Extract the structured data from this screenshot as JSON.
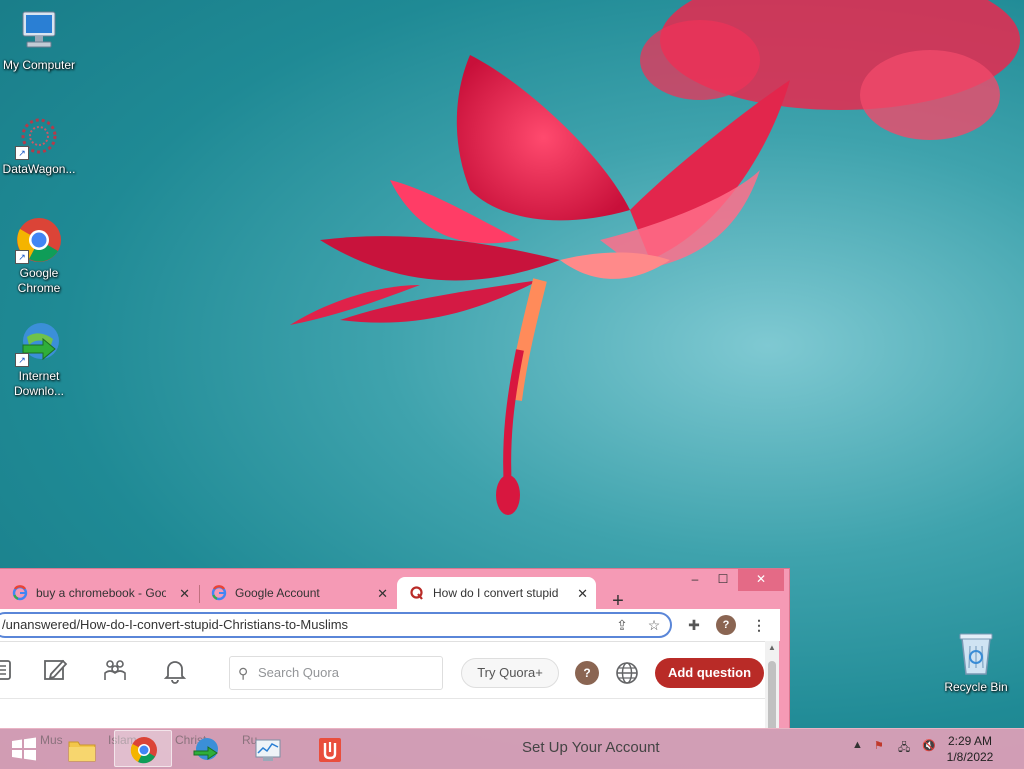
{
  "desktop": {
    "icons": [
      {
        "label": "My Computer"
      },
      {
        "label": "DataWagon..."
      },
      {
        "label": "Google Chrome"
      },
      {
        "label": "Internet Downlo..."
      },
      {
        "label": "Recycle Bin"
      }
    ]
  },
  "browser": {
    "tabs": [
      {
        "title": "buy a chromebook - Goo",
        "active": false
      },
      {
        "title": "Google Account",
        "active": false
      },
      {
        "title": "How do I convert stupid",
        "active": true
      }
    ],
    "new_tab_label": "+",
    "window_controls": {
      "minimize": "–",
      "maximize": "☐",
      "close": "✕"
    },
    "address": "/unanswered/How-do-I-convert-stupid-Christians-to-Muslims",
    "profile_initial": "?",
    "quora": {
      "search_placeholder": "Search Quora",
      "try_label": "Try Quora+",
      "help_label": "?",
      "add_question_label": "Add question"
    }
  },
  "taskbar": {
    "background_text": [
      "Mus",
      "Islam",
      "Christ",
      "Ru..."
    ],
    "setup_label": "Set Up Your Account",
    "time": "2:29 AM",
    "date": "1/8/2022"
  },
  "colors": {
    "quora_red": "#b92b27",
    "window_frame": "#f59ab5",
    "omnibox_border": "#5a86d8"
  }
}
